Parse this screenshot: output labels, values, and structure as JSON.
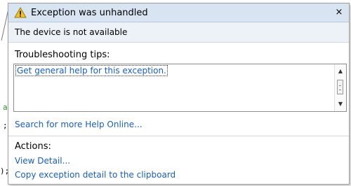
{
  "popup": {
    "title": "Exception was unhandled",
    "close_glyph": "×",
    "message": "The device is not available",
    "tips_heading": "Troubleshooting tips:",
    "tips": [
      "Get general help for this exception."
    ],
    "search_link": "Search for more Help Online...",
    "actions_heading": "Actions:",
    "actions": [
      "View Detail...",
      "Copy exception detail to the clipboard"
    ]
  },
  "background_code": {
    "frag_a": "a",
    "frag_semicolon": ";",
    "frag_paren": ");"
  },
  "icons": {
    "warning": "warning-icon",
    "close": "close-icon",
    "scroll_up": "scroll-up-icon",
    "scroll_down": "scroll-down-icon"
  },
  "colors": {
    "title_bar": "#d9e4f2",
    "message_band": "#edf2f8",
    "link": "#1a5fb4",
    "warning_fill": "#f2c12e"
  }
}
